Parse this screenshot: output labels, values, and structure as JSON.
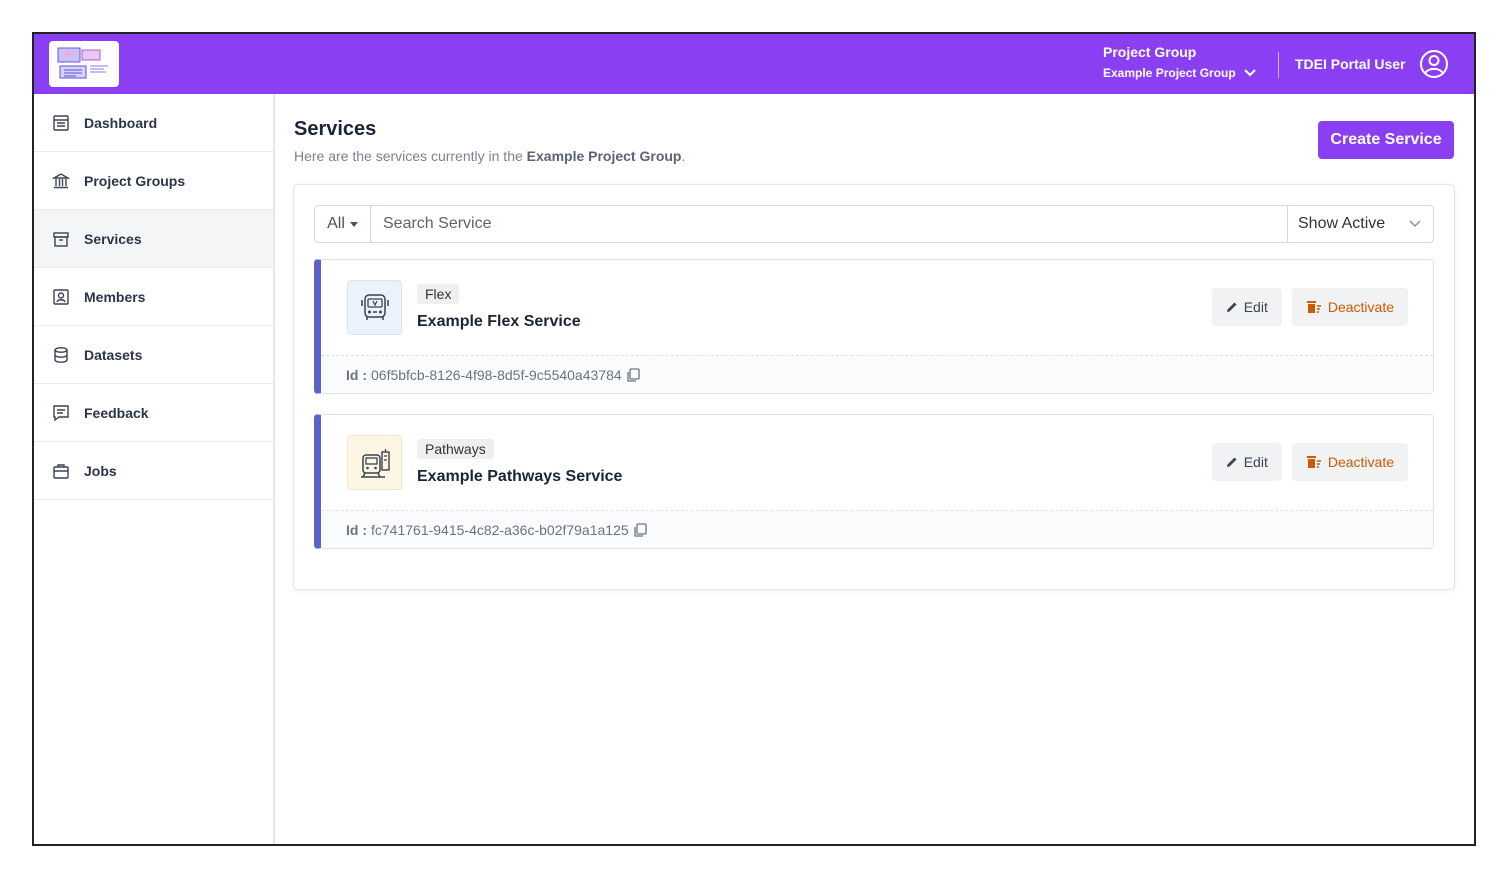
{
  "header": {
    "logo_icon": "tdei-logo-icon",
    "project_group_label": "Project Group",
    "project_group_value": "Example Project Group",
    "user_name": "TDEI Portal User",
    "brand_color": "#8a3ff2"
  },
  "sidebar": {
    "items": [
      {
        "label": "Dashboard",
        "icon": "dashboard-icon"
      },
      {
        "label": "Project Groups",
        "icon": "bank-icon"
      },
      {
        "label": "Services",
        "icon": "archive-icon"
      },
      {
        "label": "Members",
        "icon": "member-badge-icon"
      },
      {
        "label": "Datasets",
        "icon": "database-icon"
      },
      {
        "label": "Feedback",
        "icon": "feedback-icon"
      },
      {
        "label": "Jobs",
        "icon": "briefcase-icon"
      }
    ],
    "active": "Services"
  },
  "main": {
    "title": "Services",
    "subtitle_prefix": "Here are the services currently in the ",
    "subtitle_group": "Example Project Group",
    "subtitle_suffix": ".",
    "create_label": "Create Service",
    "filter_type": "All",
    "search_placeholder": "Search Service",
    "status_filter": "Show Active",
    "edit_label": "Edit",
    "deactivate_label": "Deactivate",
    "id_label": "Id :",
    "services": [
      {
        "type": "Flex",
        "name": "Example Flex Service",
        "id": "06f5bfcb-8126-4f98-8d5f-9c5540a43784",
        "icon": "bus-icon"
      },
      {
        "type": "Pathways",
        "name": "Example Pathways Service",
        "id": "fc741761-9415-4c82-a36c-b02f79a1a125",
        "icon": "train-station-icon"
      }
    ]
  }
}
